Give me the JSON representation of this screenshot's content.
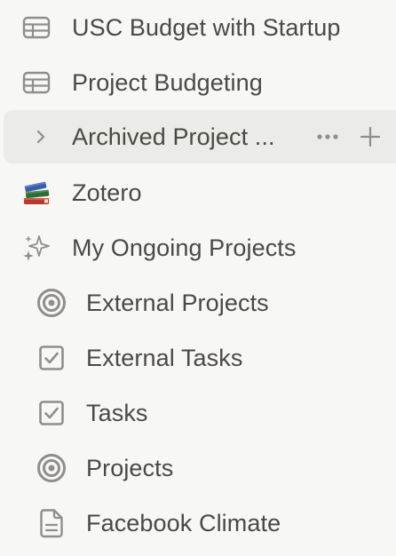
{
  "colors": {
    "background": "#f7f7f5",
    "hover": "#ebebe8",
    "text": "#4a4944",
    "icon": "#8f8e8a"
  },
  "sidebar": {
    "items": [
      {
        "label": "USC Budget with Startup",
        "icon": "table-icon"
      },
      {
        "label": "Project Budgeting",
        "icon": "table-icon"
      },
      {
        "label": "Archived Project ...",
        "icon": "chevron-right-icon",
        "hovered": true
      },
      {
        "label": "Zotero",
        "icon": "books-emoji-icon",
        "emoji": "📚"
      },
      {
        "label": "My Ongoing Projects",
        "icon": "sparkles-icon"
      }
    ],
    "children": [
      {
        "label": "External Projects",
        "icon": "target-icon"
      },
      {
        "label": "External Tasks",
        "icon": "checkbox-icon"
      },
      {
        "label": "Tasks",
        "icon": "checkbox-icon"
      },
      {
        "label": "Projects",
        "icon": "target-icon"
      },
      {
        "label": "Facebook Climate",
        "icon": "document-icon"
      }
    ]
  }
}
